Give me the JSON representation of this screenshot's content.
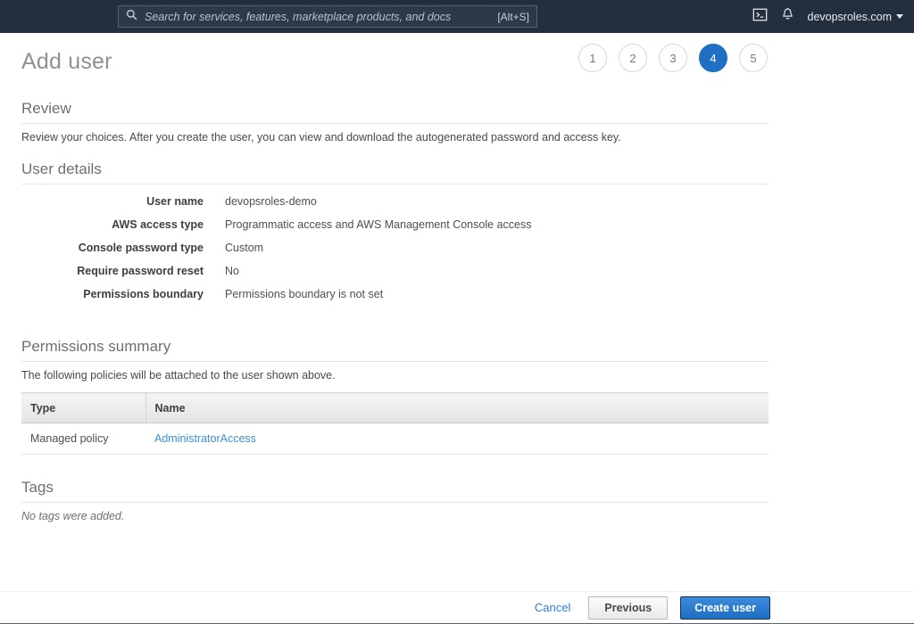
{
  "topnav": {
    "search": {
      "icon": "search-icon",
      "placeholder": "Search for services, features, marketplace products, and docs",
      "value": "",
      "shortcut_hint": "[Alt+S]"
    },
    "cloudshell_icon": "cloudshell-terminal-icon",
    "notifications_icon": "bell-icon",
    "account_label": "devopsroles.com",
    "account_caret_icon": "chevron-down-icon",
    "background_color": "#232f3e"
  },
  "page": {
    "title": "Add user",
    "steps": [
      {
        "label": "1",
        "active": false
      },
      {
        "label": "2",
        "active": false
      },
      {
        "label": "3",
        "active": false
      },
      {
        "label": "4",
        "active": true
      },
      {
        "label": "5",
        "active": false
      }
    ],
    "active_step_color": "#1f6fc4"
  },
  "review": {
    "heading": "Review",
    "description": "Review your choices. After you create the user, you can view and download the autogenerated password and access key."
  },
  "user_details": {
    "heading": "User details",
    "rows": [
      {
        "label": "User name",
        "value": "devopsroles-demo"
      },
      {
        "label": "AWS access type",
        "value": "Programmatic access and AWS Management Console access"
      },
      {
        "label": "Console password type",
        "value": "Custom"
      },
      {
        "label": "Require password reset",
        "value": "No"
      },
      {
        "label": "Permissions boundary",
        "value": "Permissions boundary is not set"
      }
    ]
  },
  "permissions_summary": {
    "heading": "Permissions summary",
    "description": "The following policies will be attached to the user shown above.",
    "table": {
      "columns": [
        "Type",
        "Name"
      ],
      "rows": [
        {
          "type": "Managed policy",
          "name": "AdministratorAccess",
          "name_is_link": true
        }
      ]
    }
  },
  "tags": {
    "heading": "Tags",
    "empty_text": "No tags were added."
  },
  "footer": {
    "cancel_label": "Cancel",
    "previous_label": "Previous",
    "create_user_label": "Create user",
    "primary_color": "#2b7cd3"
  }
}
